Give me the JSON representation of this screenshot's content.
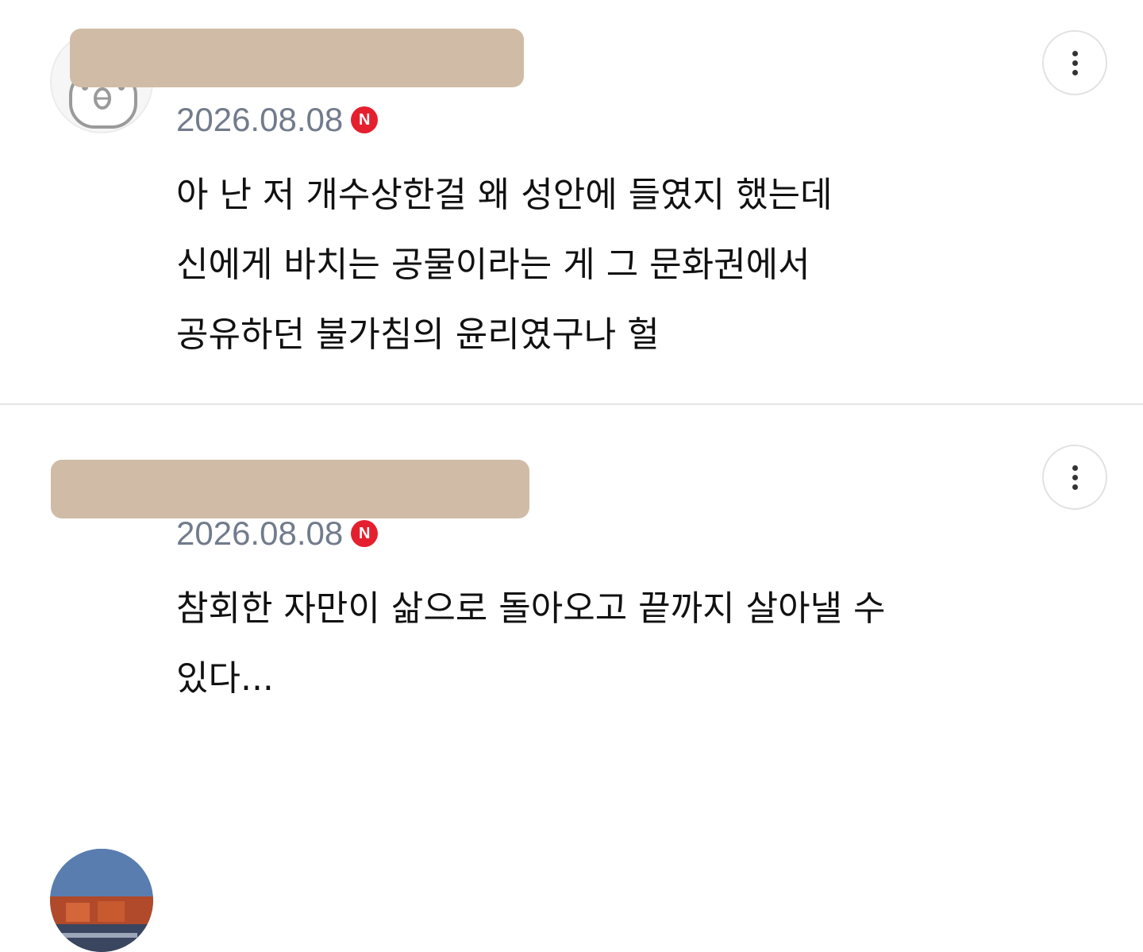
{
  "comments": [
    {
      "username": "",
      "date": "2026.08.08",
      "badge": "N",
      "body_lines": [
        "아 난 저 개수상한걸 왜 성안에 들였지 했는데",
        "신에게 바치는 공물이라는 게 그 문화권에서",
        "공유하던 불가침의 윤리였구나 헐"
      ]
    },
    {
      "username": "",
      "date": "2026.08.08",
      "badge": "N",
      "body_lines": [
        "참회한 자만이 삶으로 돌아오고 끝까지 살아낼 수",
        "있다..."
      ]
    }
  ],
  "colors": {
    "date": "#717b8c",
    "badge": "#e5202e",
    "redaction": "#d0bca6",
    "divider": "#e4e4e4"
  },
  "icons": {
    "more": "more-vertical-icon",
    "new_badge": "n-badge-icon"
  }
}
